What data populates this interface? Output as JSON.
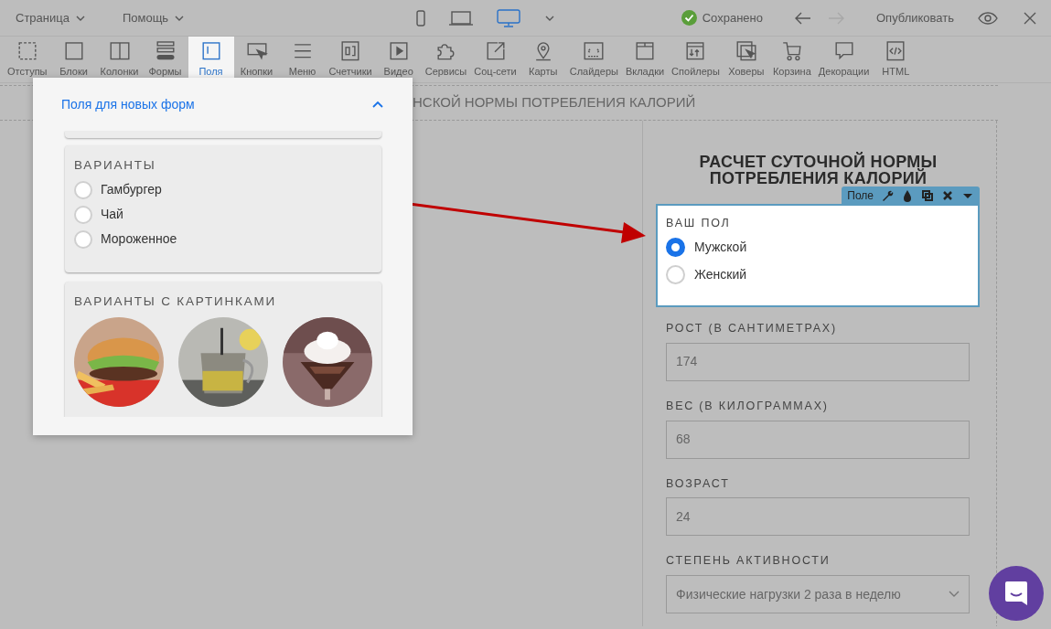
{
  "menu": [
    {
      "label": "Страница"
    },
    {
      "label": "Помощь"
    }
  ],
  "devices": [
    {
      "kind": "phone",
      "selected": false
    },
    {
      "kind": "laptop",
      "selected": false
    },
    {
      "kind": "desktop",
      "selected": true
    }
  ],
  "save_status": "Сохранено",
  "history": [
    {
      "kind": "undo",
      "disabled": false
    },
    {
      "kind": "redo",
      "disabled": true
    }
  ],
  "publish": "Опубликовать",
  "tools": [
    {
      "label": "Отступы",
      "selected": false
    },
    {
      "label": "Блоки",
      "selected": false
    },
    {
      "label": "Колонки",
      "selected": false
    },
    {
      "label": "Формы",
      "selected": false
    },
    {
      "label": "Поля",
      "selected": true
    },
    {
      "label": "Кнопки",
      "selected": false
    },
    {
      "label": "Меню",
      "selected": false
    },
    {
      "label": "Счетчики",
      "selected": false
    },
    {
      "label": "Видео",
      "selected": false
    },
    {
      "label": "Сервисы",
      "selected": false
    },
    {
      "label": "Соц-сети",
      "selected": false
    },
    {
      "label": "Карты",
      "selected": false
    },
    {
      "label": "Слайдеры",
      "selected": false
    },
    {
      "label": "Вкладки",
      "selected": false
    },
    {
      "label": "Спойлеры",
      "selected": false
    },
    {
      "label": "Ховеры",
      "selected": false
    },
    {
      "label": "Корзина",
      "selected": false
    },
    {
      "label": "Декорации",
      "selected": false
    },
    {
      "label": "HTML",
      "selected": false
    }
  ],
  "section_title": "НСКОЙ НОРМЫ ПОТРЕБЛЕНИЯ КАЛОРИЙ",
  "panel": {
    "title": "Поля для новых форм",
    "expanded": true,
    "groups": [
      {
        "kind": "radio",
        "title": "ВАРИАНТЫ",
        "options": [
          {
            "label": "Гамбургер",
            "selected": false
          },
          {
            "label": "Чай",
            "selected": false
          },
          {
            "label": "Мороженное",
            "selected": false
          }
        ]
      },
      {
        "kind": "images",
        "title": "ВАРИАНТЫ С КАРТИНКАМИ"
      }
    ]
  },
  "form": {
    "title": "РАСЧЕТ СУТОЧНОЙ НОРМЫ ПОТРЕБЛЕНИЯ КАЛОРИЙ",
    "field_toolbar": "Поле",
    "fields": [
      {
        "kind": "radio",
        "label": "ВАШ ПОЛ",
        "selected": true,
        "options": [
          {
            "label": "Мужской",
            "selected": true
          },
          {
            "label": "Женский",
            "selected": false
          }
        ]
      },
      {
        "kind": "text",
        "label": "РОСТ (В САНТИМЕТРАХ)",
        "value": "174",
        "selected": false
      },
      {
        "kind": "text",
        "label": "ВЕС (В КИЛОГРАММАХ)",
        "value": "68",
        "selected": false
      },
      {
        "kind": "text",
        "label": "ВОЗРАСТ",
        "value": "24",
        "selected": false
      },
      {
        "kind": "select",
        "label": "СТЕПЕНЬ АКТИВНОСТИ",
        "value": "Физические нагрузки 2 раза в неделю",
        "selected": false
      }
    ]
  }
}
